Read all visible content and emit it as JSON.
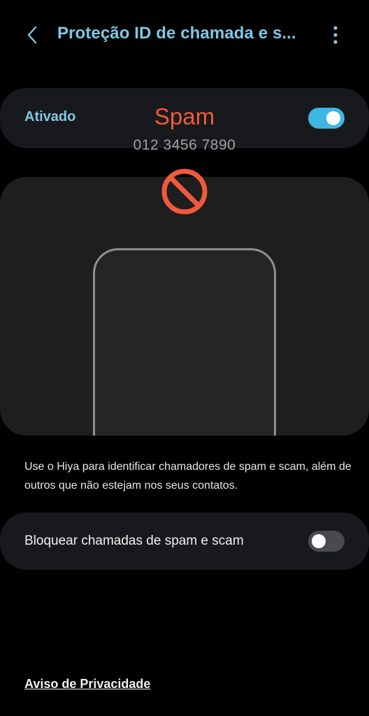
{
  "header": {
    "title": "Proteção ID de chamada e s...",
    "back_icon": "chevron-left-icon",
    "more_icon": "more-vertical-icon"
  },
  "master_switch": {
    "label": "Ativado",
    "state": "on"
  },
  "illustration": {
    "spam_label": "Spam",
    "phone_number": "012 3456 7890",
    "icon": "block-icon"
  },
  "description": "Use o Hiya para identificar chamadores de spam e scam, além de outros que não estejam nos seus contatos.",
  "block_setting": {
    "label": "Bloquear chamadas de spam e scam",
    "state": "off"
  },
  "privacy_link": "Aviso de Privacidade",
  "colors": {
    "accent": "#7fc8e6",
    "toggle_on": "#3bb7e1",
    "spam_red": "#ef5a3c",
    "background": "#000000",
    "card": "#17191c"
  }
}
